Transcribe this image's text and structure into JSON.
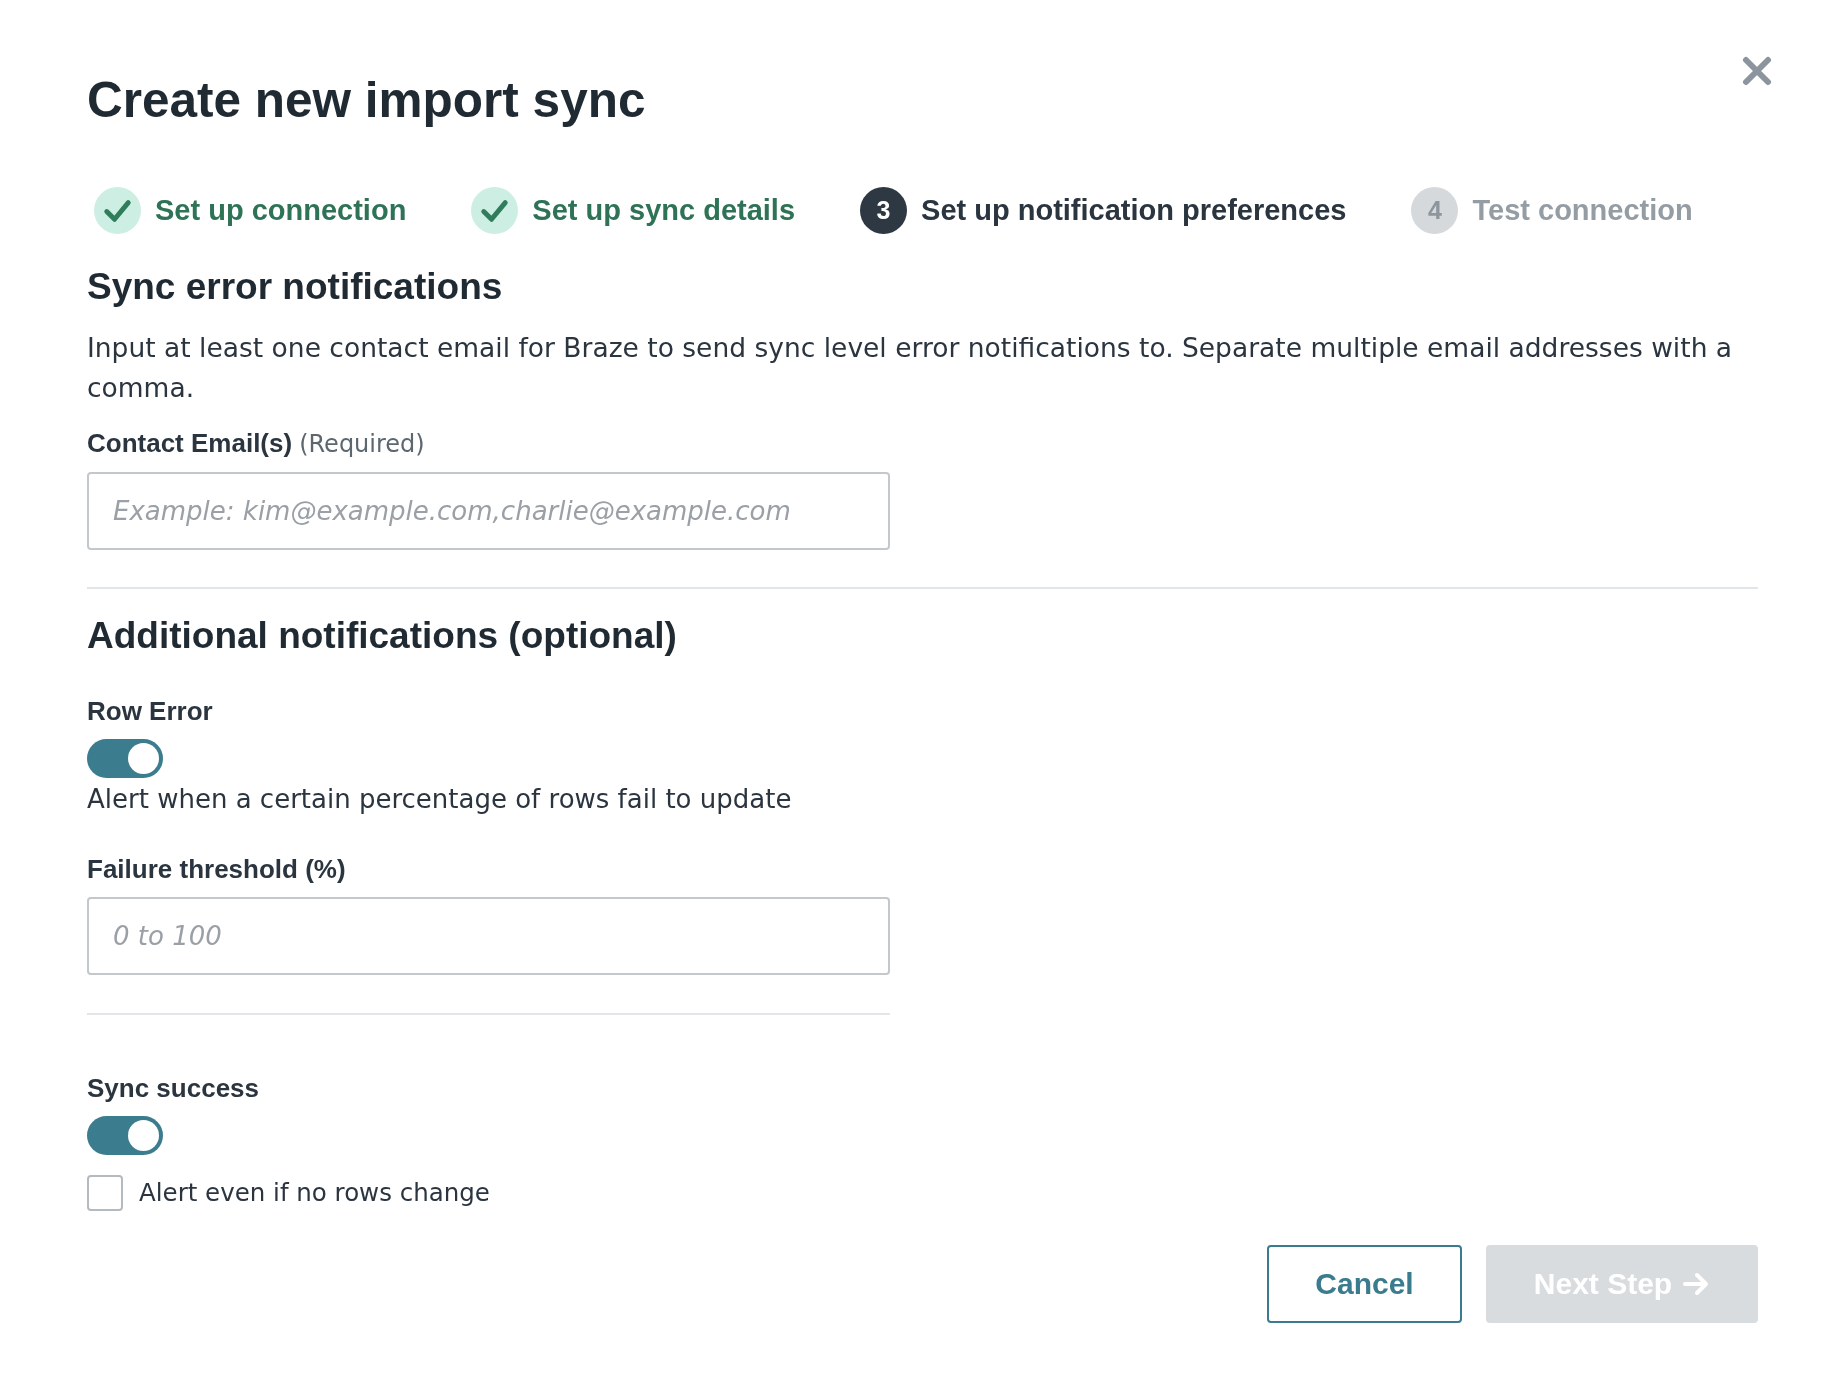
{
  "dialog": {
    "title": "Create new import sync"
  },
  "steps": [
    {
      "label": "Set up connection",
      "completed": true,
      "selected": false
    },
    {
      "label": "Set up sync details",
      "completed": true,
      "selected": false
    },
    {
      "number": "3",
      "label": "Set up notification preferences",
      "completed": false,
      "selected": true
    },
    {
      "number": "4",
      "label": "Test connection",
      "completed": false,
      "selected": false
    }
  ],
  "sync_error_notifications": {
    "heading": "Sync error notifications",
    "description": "Input at least one contact email for Braze to send sync level error notifications to. Separate multiple email addresses with a comma.",
    "contact_email_field": {
      "label": "Contact Email(s)",
      "hint": "(Required)",
      "placeholder": "Example: kim@example.com,charlie@example.com"
    }
  },
  "additional_notifications": {
    "heading": "Additional notifications (optional)",
    "row_error": {
      "label": "Row Error",
      "on": true,
      "description": "Alert when a certain percentage of rows fail to update",
      "failure_threshold_field": {
        "label": "Failure threshold (%)",
        "placeholder": "0 to 100"
      }
    },
    "sync_success": {
      "label": "Sync success",
      "on": true,
      "checkbox": {
        "label": "Alert even if no rows change",
        "checked": false
      }
    }
  },
  "buttons": [
    {
      "label": "Cancel",
      "kind": "secondary",
      "disabled": false
    },
    {
      "label": "Next Step",
      "kind": "primary",
      "disabled": true
    }
  ]
}
